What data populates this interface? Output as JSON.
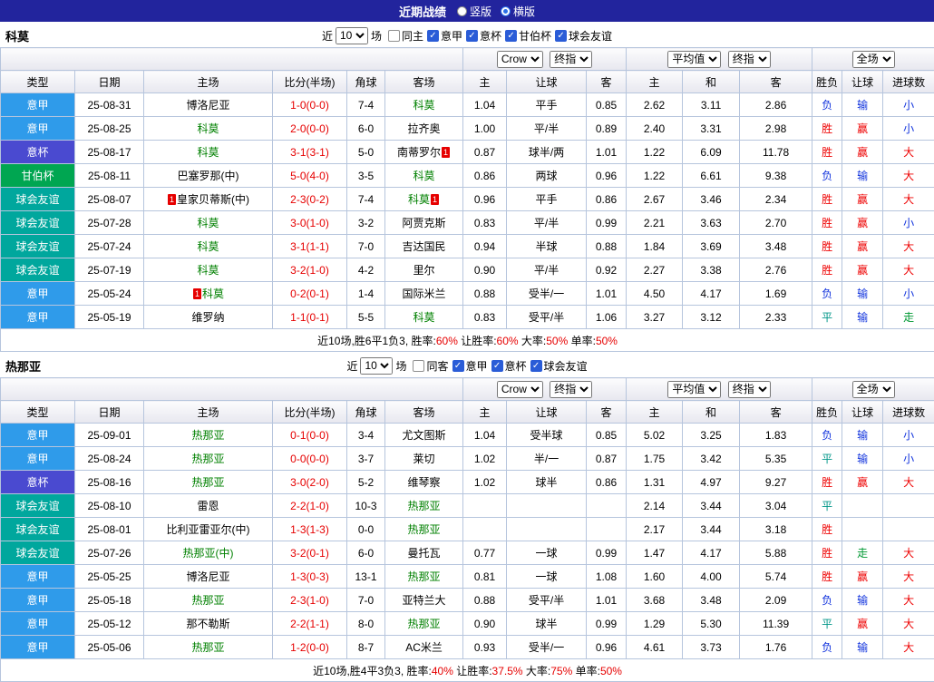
{
  "topbar": {
    "title": "近期战绩",
    "radios": [
      {
        "name": "vertical-layout",
        "label": "竖版",
        "selected": false
      },
      {
        "name": "horizontal-layout",
        "label": "横版",
        "selected": true
      }
    ]
  },
  "filter_labels": {
    "near": "近",
    "games": "场"
  },
  "header": {
    "type": "类型",
    "date": "日期",
    "home": "主场",
    "score": "比分(半场)",
    "corner": "角球",
    "away": "客场",
    "odds_selects": [
      "Crow",
      "终指"
    ],
    "odds_cols": [
      "主",
      "让球",
      "客"
    ],
    "avg_selects": [
      "平均值",
      "终指"
    ],
    "avg_cols": [
      "主",
      "和",
      "客"
    ],
    "full_select": "全场",
    "full_cols": [
      "胜负",
      "让球",
      "进球数"
    ]
  },
  "colors": {
    "type": {
      "意甲": "#2f9bea",
      "意杯": "#4a4ad0",
      "甘伯杯": "#00a651",
      "球会友谊": "#00a79d"
    },
    "result": {
      "胜": "#ee0000",
      "负": "#1133dd",
      "平": "#009688",
      "赢": "#ee0000",
      "输": "#1133dd",
      "走": "#009933",
      "大": "#ee0000",
      "小": "#1133dd"
    },
    "self_team": "#008000",
    "score": "#e60000"
  },
  "sections": [
    {
      "team": "科莫",
      "filter_count": "10",
      "checkboxes": [
        {
          "name": "same-home",
          "label": "同主",
          "checked": false
        },
        {
          "name": "serie-a",
          "label": "意甲",
          "checked": true
        },
        {
          "name": "coppa-italia",
          "label": "意杯",
          "checked": true
        },
        {
          "name": "gamper-cup",
          "label": "甘伯杯",
          "checked": true
        },
        {
          "name": "club-friendly",
          "label": "球会友谊",
          "checked": true
        }
      ],
      "rows": [
        {
          "type": "意甲",
          "date": "25-08-31",
          "home": {
            "name": "博洛尼亚",
            "self": false
          },
          "score": "1-0(0-0)",
          "corner": "7-4",
          "away": {
            "name": "科莫",
            "self": true
          },
          "odds": [
            "1.04",
            "平手",
            "0.85"
          ],
          "avg": [
            "2.62",
            "3.11",
            "2.86"
          ],
          "results": [
            "负",
            "输",
            "小"
          ]
        },
        {
          "type": "意甲",
          "date": "25-08-25",
          "home": {
            "name": "科莫",
            "self": true
          },
          "score": "2-0(0-0)",
          "corner": "6-0",
          "away": {
            "name": "拉齐奥",
            "self": false
          },
          "odds": [
            "1.00",
            "平/半",
            "0.89"
          ],
          "avg": [
            "2.40",
            "3.31",
            "2.98"
          ],
          "results": [
            "胜",
            "赢",
            "小"
          ]
        },
        {
          "type": "意杯",
          "date": "25-08-17",
          "home": {
            "name": "科莫",
            "self": true
          },
          "score": "3-1(3-1)",
          "corner": "5-0",
          "away": {
            "name": "南蒂罗尔",
            "self": false,
            "card_post": "1"
          },
          "odds": [
            "0.87",
            "球半/两",
            "1.01"
          ],
          "avg": [
            "1.22",
            "6.09",
            "11.78"
          ],
          "results": [
            "胜",
            "赢",
            "大"
          ]
        },
        {
          "type": "甘伯杯",
          "date": "25-08-11",
          "home": {
            "name": "巴塞罗那(中)",
            "self": false
          },
          "score": "5-0(4-0)",
          "corner": "3-5",
          "away": {
            "name": "科莫",
            "self": true
          },
          "odds": [
            "0.86",
            "两球",
            "0.96"
          ],
          "avg": [
            "1.22",
            "6.61",
            "9.38"
          ],
          "results": [
            "负",
            "输",
            "大"
          ]
        },
        {
          "type": "球会友谊",
          "date": "25-08-07",
          "home": {
            "name": "皇家贝蒂斯(中)",
            "self": false,
            "card_pre": "1"
          },
          "score": "2-3(0-2)",
          "corner": "7-4",
          "away": {
            "name": "科莫",
            "self": true,
            "card_post": "1"
          },
          "odds": [
            "0.96",
            "平手",
            "0.86"
          ],
          "avg": [
            "2.67",
            "3.46",
            "2.34"
          ],
          "results": [
            "胜",
            "赢",
            "大"
          ]
        },
        {
          "type": "球会友谊",
          "date": "25-07-28",
          "home": {
            "name": "科莫",
            "self": true
          },
          "score": "3-0(1-0)",
          "corner": "3-2",
          "away": {
            "name": "阿贾克斯",
            "self": false
          },
          "odds": [
            "0.83",
            "平/半",
            "0.99"
          ],
          "avg": [
            "2.21",
            "3.63",
            "2.70"
          ],
          "results": [
            "胜",
            "赢",
            "小"
          ]
        },
        {
          "type": "球会友谊",
          "date": "25-07-24",
          "home": {
            "name": "科莫",
            "self": true
          },
          "score": "3-1(1-1)",
          "corner": "7-0",
          "away": {
            "name": "吉达国民",
            "self": false
          },
          "odds": [
            "0.94",
            "半球",
            "0.88"
          ],
          "avg": [
            "1.84",
            "3.69",
            "3.48"
          ],
          "results": [
            "胜",
            "赢",
            "大"
          ]
        },
        {
          "type": "球会友谊",
          "date": "25-07-19",
          "home": {
            "name": "科莫",
            "self": true
          },
          "score": "3-2(1-0)",
          "corner": "4-2",
          "away": {
            "name": "里尔",
            "self": false
          },
          "odds": [
            "0.90",
            "平/半",
            "0.92"
          ],
          "avg": [
            "2.27",
            "3.38",
            "2.76"
          ],
          "results": [
            "胜",
            "赢",
            "大"
          ]
        },
        {
          "type": "意甲",
          "date": "25-05-24",
          "home": {
            "name": "科莫",
            "self": true,
            "card_pre": "1"
          },
          "score": "0-2(0-1)",
          "corner": "1-4",
          "away": {
            "name": "国际米兰",
            "self": false
          },
          "odds": [
            "0.88",
            "受半/一",
            "1.01"
          ],
          "avg": [
            "4.50",
            "4.17",
            "1.69"
          ],
          "results": [
            "负",
            "输",
            "小"
          ]
        },
        {
          "type": "意甲",
          "date": "25-05-19",
          "home": {
            "name": "维罗纳",
            "self": false
          },
          "score": "1-1(0-1)",
          "corner": "5-5",
          "away": {
            "name": "科莫",
            "self": true
          },
          "odds": [
            "0.83",
            "受平/半",
            "1.06"
          ],
          "avg": [
            "3.27",
            "3.12",
            "2.33"
          ],
          "results": [
            "平",
            "输",
            "走"
          ]
        }
      ],
      "summary": [
        {
          "text": "近10场,胜6平1负3, 胜率:",
          "red": false
        },
        {
          "text": "60%",
          "red": true
        },
        {
          "text": " 让胜率:",
          "red": false
        },
        {
          "text": "60%",
          "red": true
        },
        {
          "text": " 大率:",
          "red": false
        },
        {
          "text": "50%",
          "red": true
        },
        {
          "text": " 单率:",
          "red": false
        },
        {
          "text": "50%",
          "red": true
        }
      ]
    },
    {
      "team": "热那亚",
      "filter_count": "10",
      "checkboxes": [
        {
          "name": "same-away",
          "label": "同客",
          "checked": false
        },
        {
          "name": "serie-a",
          "label": "意甲",
          "checked": true
        },
        {
          "name": "coppa-italia",
          "label": "意杯",
          "checked": true
        },
        {
          "name": "club-friendly",
          "label": "球会友谊",
          "checked": true
        }
      ],
      "rows": [
        {
          "type": "意甲",
          "date": "25-09-01",
          "home": {
            "name": "热那亚",
            "self": true
          },
          "score": "0-1(0-0)",
          "corner": "3-4",
          "away": {
            "name": "尤文图斯",
            "self": false
          },
          "odds": [
            "1.04",
            "受半球",
            "0.85"
          ],
          "avg": [
            "5.02",
            "3.25",
            "1.83"
          ],
          "results": [
            "负",
            "输",
            "小"
          ]
        },
        {
          "type": "意甲",
          "date": "25-08-24",
          "home": {
            "name": "热那亚",
            "self": true
          },
          "score": "0-0(0-0)",
          "corner": "3-7",
          "away": {
            "name": "莱切",
            "self": false
          },
          "odds": [
            "1.02",
            "半/一",
            "0.87"
          ],
          "avg": [
            "1.75",
            "3.42",
            "5.35"
          ],
          "results": [
            "平",
            "输",
            "小"
          ]
        },
        {
          "type": "意杯",
          "date": "25-08-16",
          "home": {
            "name": "热那亚",
            "self": true
          },
          "score": "3-0(2-0)",
          "corner": "5-2",
          "away": {
            "name": "维琴察",
            "self": false
          },
          "odds": [
            "1.02",
            "球半",
            "0.86"
          ],
          "avg": [
            "1.31",
            "4.97",
            "9.27"
          ],
          "results": [
            "胜",
            "赢",
            "大"
          ]
        },
        {
          "type": "球会友谊",
          "date": "25-08-10",
          "home": {
            "name": "雷恩",
            "self": false
          },
          "score": "2-2(1-0)",
          "corner": "10-3",
          "away": {
            "name": "热那亚",
            "self": true
          },
          "odds": [
            "",
            "",
            ""
          ],
          "avg": [
            "2.14",
            "3.44",
            "3.04"
          ],
          "results": [
            "平",
            "",
            ""
          ]
        },
        {
          "type": "球会友谊",
          "date": "25-08-01",
          "home": {
            "name": "比利亚雷亚尔(中)",
            "self": false
          },
          "score": "1-3(1-3)",
          "corner": "0-0",
          "away": {
            "name": "热那亚",
            "self": true
          },
          "odds": [
            "",
            "",
            ""
          ],
          "avg": [
            "2.17",
            "3.44",
            "3.18"
          ],
          "results": [
            "胜",
            "",
            ""
          ]
        },
        {
          "type": "球会友谊",
          "date": "25-07-26",
          "home": {
            "name": "热那亚(中)",
            "self": true
          },
          "score": "3-2(0-1)",
          "corner": "6-0",
          "away": {
            "name": "曼托瓦",
            "self": false
          },
          "odds": [
            "0.77",
            "一球",
            "0.99"
          ],
          "avg": [
            "1.47",
            "4.17",
            "5.88"
          ],
          "results": [
            "胜",
            "走",
            "大"
          ]
        },
        {
          "type": "意甲",
          "date": "25-05-25",
          "home": {
            "name": "博洛尼亚",
            "self": false
          },
          "score": "1-3(0-3)",
          "corner": "13-1",
          "away": {
            "name": "热那亚",
            "self": true
          },
          "odds": [
            "0.81",
            "一球",
            "1.08"
          ],
          "avg": [
            "1.60",
            "4.00",
            "5.74"
          ],
          "results": [
            "胜",
            "赢",
            "大"
          ]
        },
        {
          "type": "意甲",
          "date": "25-05-18",
          "home": {
            "name": "热那亚",
            "self": true
          },
          "score": "2-3(1-0)",
          "corner": "7-0",
          "away": {
            "name": "亚特兰大",
            "self": false
          },
          "odds": [
            "0.88",
            "受平/半",
            "1.01"
          ],
          "avg": [
            "3.68",
            "3.48",
            "2.09"
          ],
          "results": [
            "负",
            "输",
            "大"
          ]
        },
        {
          "type": "意甲",
          "date": "25-05-12",
          "home": {
            "name": "那不勒斯",
            "self": false
          },
          "score": "2-2(1-1)",
          "corner": "8-0",
          "away": {
            "name": "热那亚",
            "self": true
          },
          "odds": [
            "0.90",
            "球半",
            "0.99"
          ],
          "avg": [
            "1.29",
            "5.30",
            "11.39"
          ],
          "results": [
            "平",
            "赢",
            "大"
          ]
        },
        {
          "type": "意甲",
          "date": "25-05-06",
          "home": {
            "name": "热那亚",
            "self": true
          },
          "score": "1-2(0-0)",
          "corner": "8-7",
          "away": {
            "name": "AC米兰",
            "self": false
          },
          "odds": [
            "0.93",
            "受半/一",
            "0.96"
          ],
          "avg": [
            "4.61",
            "3.73",
            "1.76"
          ],
          "results": [
            "负",
            "输",
            "大"
          ]
        }
      ],
      "summary": [
        {
          "text": "近10场,胜4平3负3, 胜率:",
          "red": false
        },
        {
          "text": "40%",
          "red": true
        },
        {
          "text": " 让胜率:",
          "red": false
        },
        {
          "text": "37.5%",
          "red": true
        },
        {
          "text": " 大率:",
          "red": false
        },
        {
          "text": "75%",
          "red": true
        },
        {
          "text": " 单率:",
          "red": false
        },
        {
          "text": "50%",
          "red": true
        }
      ]
    }
  ]
}
